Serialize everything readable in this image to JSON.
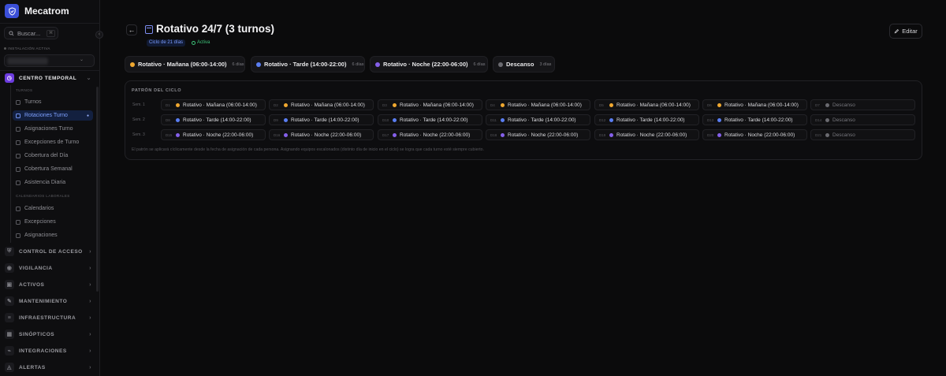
{
  "app": {
    "name": "Mecatrom"
  },
  "sidebar": {
    "search_placeholder": "Buscar...",
    "search_shortcut": "⌘",
    "installation_label": "INSTALACIÓN ACTIVA",
    "groups": [
      {
        "label": "CENTRO TEMPORAL",
        "icon": "clock-icon",
        "expanded": true
      },
      {
        "label": "CONTROL DE ACCESO",
        "icon": "shield-icon"
      },
      {
        "label": "VIGILANCIA",
        "icon": "camera-icon"
      },
      {
        "label": "ACTIVOS",
        "icon": "box-icon"
      },
      {
        "label": "MANTENIMIENTO",
        "icon": "wrench-icon"
      },
      {
        "label": "INFRAESTRUCTURA",
        "icon": "server-icon"
      },
      {
        "label": "SINÓPTICOS",
        "icon": "grid-icon"
      },
      {
        "label": "INTEGRACIONES",
        "icon": "plug-icon"
      },
      {
        "label": "ALERTAS",
        "icon": "bell-icon"
      }
    ],
    "section_turnos": "TURNOS",
    "turnos_items": [
      {
        "label": "Turnos"
      },
      {
        "label": "Rotaciones Turno",
        "active": true
      },
      {
        "label": "Asignaciones Turno"
      },
      {
        "label": "Excepciones de Turno"
      },
      {
        "label": "Cobertura del Día"
      },
      {
        "label": "Cobertura Semanal"
      },
      {
        "label": "Asistencia Diaria"
      }
    ],
    "section_calendarios": "CALENDARIOS LABORALES",
    "calendar_items": [
      {
        "label": "Calendarios"
      },
      {
        "label": "Excepciones"
      },
      {
        "label": "Asignaciones"
      }
    ]
  },
  "header": {
    "title": "Rotativo 24/7 (3 turnos)",
    "cycle_badge": "Ciclo de 21 días",
    "status_badge": "Activa",
    "edit_label": "Editar"
  },
  "legend": [
    {
      "label": "Rotativo · Mañana (06:00-14:00)",
      "count": "6 días",
      "color": "#f0a830"
    },
    {
      "label": "Rotativo · Tarde (14:00-22:00)",
      "count": "6 días",
      "color": "#5a7ef2"
    },
    {
      "label": "Rotativo · Noche (22:00-06:00)",
      "count": "6 días",
      "color": "#8560ea"
    },
    {
      "label": "Descanso",
      "count": "3 días",
      "color": "#6a6a70"
    }
  ],
  "pattern": {
    "title": "PATRÓN DEL CICLO",
    "weeks": [
      {
        "label": "Sem. 1",
        "days": [
          {
            "day": "D1",
            "label": "Rotativo · Mañana (06:00-14:00)",
            "color": "#f0a830"
          },
          {
            "day": "D2",
            "label": "Rotativo · Mañana (06:00-14:00)",
            "color": "#f0a830"
          },
          {
            "day": "D3",
            "label": "Rotativo · Mañana (06:00-14:00)",
            "color": "#f0a830"
          },
          {
            "day": "D4",
            "label": "Rotativo · Mañana (06:00-14:00)",
            "color": "#f0a830"
          },
          {
            "day": "D5",
            "label": "Rotativo · Mañana (06:00-14:00)",
            "color": "#f0a830"
          },
          {
            "day": "D6",
            "label": "Rotativo · Mañana (06:00-14:00)",
            "color": "#f0a830"
          },
          {
            "day": "D7",
            "label": "Descanso",
            "color": "#6a6a70",
            "rest": true
          }
        ]
      },
      {
        "label": "Sem. 2",
        "days": [
          {
            "day": "D8",
            "label": "Rotativo · Tarde (14:00-22:00)",
            "color": "#5a7ef2"
          },
          {
            "day": "D9",
            "label": "Rotativo · Tarde (14:00-22:00)",
            "color": "#5a7ef2"
          },
          {
            "day": "D10",
            "label": "Rotativo · Tarde (14:00-22:00)",
            "color": "#5a7ef2"
          },
          {
            "day": "D11",
            "label": "Rotativo · Tarde (14:00-22:00)",
            "color": "#5a7ef2"
          },
          {
            "day": "D12",
            "label": "Rotativo · Tarde (14:00-22:00)",
            "color": "#5a7ef2"
          },
          {
            "day": "D13",
            "label": "Rotativo · Tarde (14:00-22:00)",
            "color": "#5a7ef2"
          },
          {
            "day": "D14",
            "label": "Descanso",
            "color": "#6a6a70",
            "rest": true
          }
        ]
      },
      {
        "label": "Sem. 3",
        "days": [
          {
            "day": "D15",
            "label": "Rotativo · Noche (22:00-06:00)",
            "color": "#8560ea"
          },
          {
            "day": "D16",
            "label": "Rotativo · Noche (22:00-06:00)",
            "color": "#8560ea"
          },
          {
            "day": "D17",
            "label": "Rotativo · Noche (22:00-06:00)",
            "color": "#8560ea"
          },
          {
            "day": "D18",
            "label": "Rotativo · Noche (22:00-06:00)",
            "color": "#8560ea"
          },
          {
            "day": "D19",
            "label": "Rotativo · Noche (22:00-06:00)",
            "color": "#8560ea"
          },
          {
            "day": "D20",
            "label": "Rotativo · Noche (22:00-06:00)",
            "color": "#8560ea"
          },
          {
            "day": "D21",
            "label": "Descanso",
            "color": "#6a6a70",
            "rest": true
          }
        ]
      }
    ],
    "note": "El patrón se aplicará cíclicamente desde la fecha de asignación de cada persona. Asignando equipos escalonados (distinto día de inicio en el ciclo) se logra que cada turno esté siempre cubierto."
  }
}
